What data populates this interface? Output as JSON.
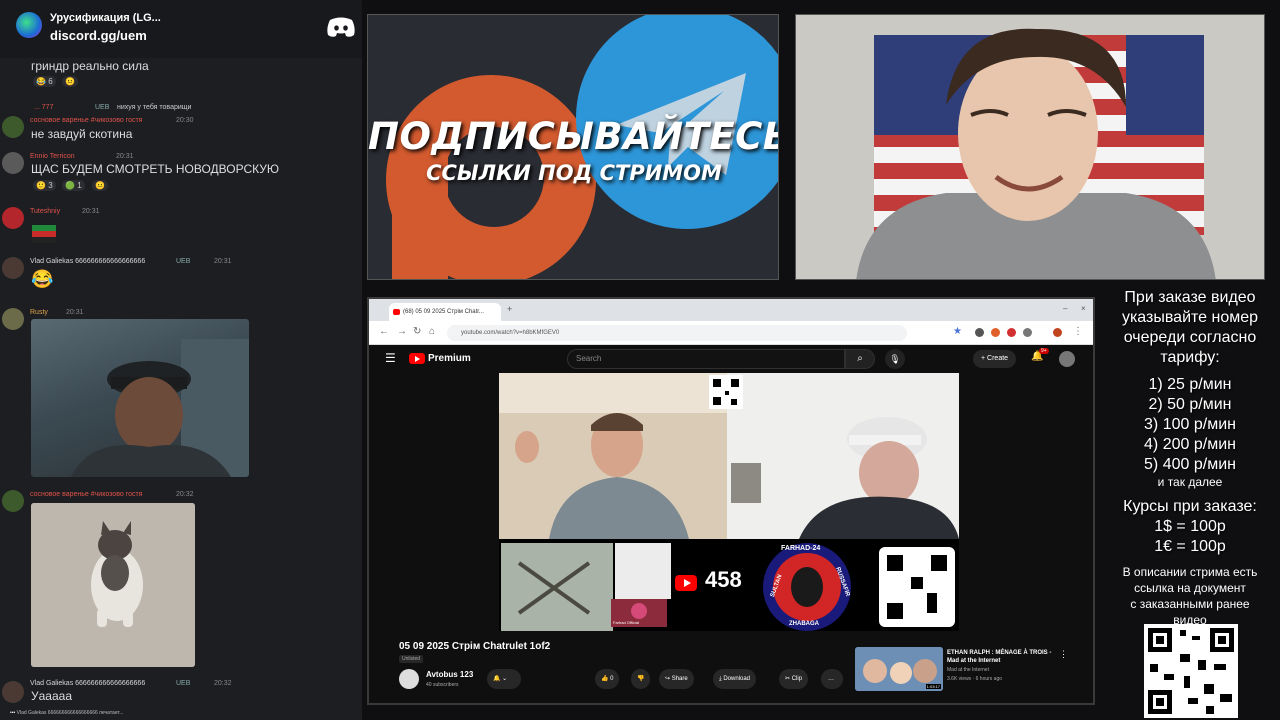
{
  "discord": {
    "server_name": "Урусификация (LG...",
    "invite": "discord.gg/uem",
    "messages": [
      {
        "text": "гриндр реально сила",
        "reactions": [
          "6",
          "😐"
        ]
      },
      {
        "author": "... 777",
        "role": "UEB",
        "text_small": "нихуя у тебя товарищи"
      },
      {
        "author": "сосновое варенье #чикозово гостя",
        "time": "20:30",
        "text": "не завдуй скотина"
      },
      {
        "author": "Ennio Terricon",
        "time": "20:31",
        "text": "ЩАС БУДЕМ СМОТРЕТЬ НОВОДВОРСКУЮ",
        "reactions": [
          "3",
          "1",
          "😐"
        ]
      },
      {
        "author": "Tuteshniy",
        "time": "20:31"
      },
      {
        "author": "Vlad Galiekas 666666666666666666",
        "role": "UEB",
        "time": "20:31",
        "emoji": "😂"
      },
      {
        "author": "Rusty",
        "time": "20:31"
      },
      {
        "author": "сосновое варенье #чикозово гостя",
        "time": "20:32"
      },
      {
        "author": "Vlad Galiekas 666666666666666666",
        "role": "UEB",
        "time": "20:32",
        "text": "Уаaaaa"
      }
    ],
    "typing": "Vlad Galekas 666666666666666666 печатает..."
  },
  "promo": {
    "line1": "ПОДПИСЫВАЙТЕСЬ",
    "line2": "ССЫЛКИ ПОД СТРИМОМ"
  },
  "browser": {
    "tab_title": "(68) 05 09 2025 Стрім Chatr...",
    "url": "youtube.com/watch?v=h8bKMfGEV0",
    "yt_brand": "Premium",
    "search_placeholder": "Search",
    "create_label": "Create",
    "notif_count": "9+",
    "overlay_count": "458",
    "overlay_badge_top": "FARHAD-24",
    "overlay_badge_left": "SULTAN",
    "overlay_badge_right": "RUSSAFIR",
    "overlay_badge_bottom": "ZHABAGA",
    "overlay_cam_label": "Farhad Official",
    "video_title": "05 09 2025 Стрім Chatrulet 1of2",
    "visibility": "Unlisted",
    "channel": "Avtobus 123",
    "subscribers": "40 subscribers",
    "likes": "0",
    "share_label": "Share",
    "download_label": "Download",
    "clip_label": "Clip",
    "rec_title": "ETHAN RALPH : MÉNAGE À TROIS - Mad at the Internet",
    "rec_channel": "Mad at the Internet",
    "rec_meta": "3.6K views · 6 hours ago",
    "rec_duration": "1:03:17"
  },
  "pricing": {
    "intro": [
      "При заказе видео",
      "указывайте номер",
      "очереди согласно",
      "тарифу:"
    ],
    "tiers": [
      "1) 25 р/мин",
      "2) 50 р/мин",
      "3) 100 р/мин",
      "4) 200 р/мин",
      "5) 400 р/мин"
    ],
    "more": "и так далее",
    "rates_title": "Курсы при заказе:",
    "rates": [
      "1$ = 100р",
      "1€ = 100р"
    ],
    "note": [
      "В описании стрима есть",
      "ссылка на документ",
      "с заказанными ранее",
      "видео"
    ]
  },
  "colors": {
    "discord_bg": "#1d1e22",
    "yt_red": "#ff0000",
    "telegram_blue": "#2d96d8",
    "patreon_orange": "#d35a2f",
    "username_red": "#e0524a",
    "username_green": "#3ba55d"
  }
}
